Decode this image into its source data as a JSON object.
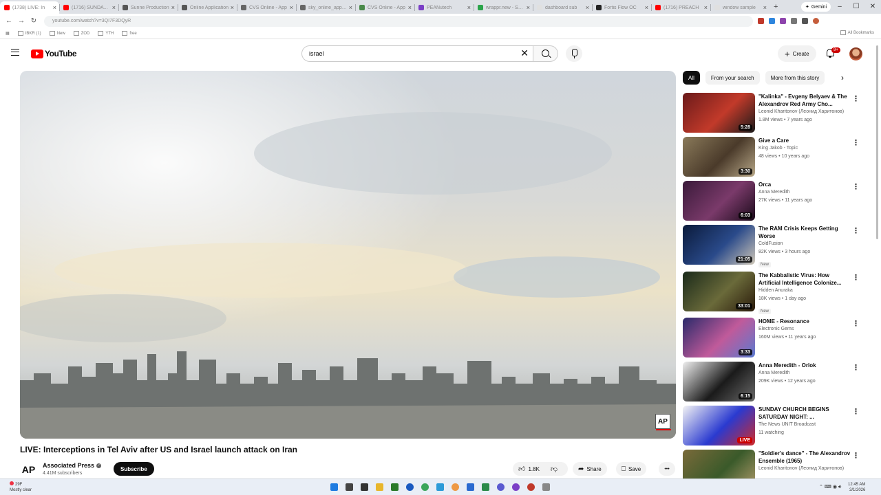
{
  "browser": {
    "tabs": [
      {
        "label": "(1738) LIVE: In",
        "color": "#ff0000",
        "active": true
      },
      {
        "label": "(1716) SUNDAY CH",
        "color": "#ff0000"
      },
      {
        "label": "Sunne Production",
        "color": "#555555"
      },
      {
        "label": "Online Application",
        "color": "#555555"
      },
      {
        "label": "CVS Online - App",
        "color": "#666666"
      },
      {
        "label": "sky_online_app_(1)",
        "color": "#666666"
      },
      {
        "label": "CVS Online - App",
        "color": "#4a8a4a"
      },
      {
        "label": "PEANutech",
        "color": "#7a3fc6"
      },
      {
        "label": "wrappr.new - Sunne",
        "color": "#2aa44a"
      },
      {
        "label": "dashboard sub",
        "color": "#e0e0e0"
      },
      {
        "label": "Fortis Flow OC",
        "color": "#222222"
      },
      {
        "label": "(1716) PREACH",
        "color": "#ff0000"
      },
      {
        "label": "window sample",
        "color": "#e0e0e0"
      }
    ],
    "new_tab": "+",
    "gemini_label": "Gemini",
    "url": "youtube.com/watch?v=3QI7F3DQyR",
    "bookmarks": [
      "IBKR (1)",
      "New",
      "ZOD",
      "YTH",
      "free"
    ],
    "all_bookmarks": "All Bookmarks",
    "window_controls": [
      "–",
      "☐",
      "✕"
    ]
  },
  "youtube": {
    "logo_text": "YouTube",
    "search_query": "israel",
    "create_label": "Create",
    "notification_count": "9+",
    "video": {
      "title": "LIVE: Interceptions in Tel Aviv after US and Israel launch attack on Iran",
      "watermark": "AP"
    },
    "channel": {
      "logo": "AP",
      "name": "Associated Press",
      "subscribers": "4.41M subscribers",
      "subscribe_label": "Subscribe"
    },
    "actions": {
      "likes": "1.8K",
      "share": "Share",
      "save": "Save",
      "more": "•••"
    },
    "chips": [
      "All",
      "From your search",
      "More from this story"
    ],
    "recommendations": [
      {
        "title": "\"Kalinka\" - Evgeny Belyaev & The Alexandrov Red Army Cho...",
        "channel": "Leonid Kharitonov (Леонид Харитонов)",
        "meta": "1.8M views • 7 years ago",
        "duration": "5:28",
        "new": "",
        "colors": [
          "#6a1a1a",
          "#c23a2a",
          "#1a1a1a"
        ]
      },
      {
        "title": "Give a Care",
        "channel": "King Jakob - Topic",
        "meta": "48 views • 10 years ago",
        "duration": "3:30",
        "new": "",
        "colors": [
          "#8a7a5a",
          "#4a3a2a",
          "#b8a888"
        ]
      },
      {
        "title": "Orca",
        "channel": "Anna Meredith",
        "meta": "27K views • 11 years ago",
        "duration": "6:03",
        "new": "",
        "colors": [
          "#3a1a3a",
          "#7a3a6a",
          "#1a0a1a"
        ]
      },
      {
        "title": "The RAM Crisis Keeps Getting Worse",
        "channel": "ColdFusion",
        "meta": "82K views • 3 hours ago",
        "duration": "21:05",
        "new": "New",
        "colors": [
          "#0a1a3a",
          "#2a4a8a",
          "#d0c8b8"
        ]
      },
      {
        "title": "The Kabbalistic Virus: How Artificial Intelligence Colonize...",
        "channel": "Hidden Anuraka",
        "meta": "18K views • 1 day ago",
        "duration": "33:01",
        "new": "New",
        "colors": [
          "#1a2a1a",
          "#6a6a3a",
          "#2a1a0a"
        ]
      },
      {
        "title": "HOME - Resonance",
        "channel": "Electronic Gems",
        "meta": "160M views • 11 years ago",
        "duration": "3:33",
        "new": "",
        "colors": [
          "#2a2a6a",
          "#c05a9a",
          "#5a7ad0"
        ]
      },
      {
        "title": "Anna Meredith - Orlok",
        "channel": "Anna Meredith",
        "meta": "209K views • 12 years ago",
        "duration": "6:15",
        "new": "",
        "colors": [
          "#f0f0f0",
          "#1a1a1a",
          "#6a6a6a"
        ]
      },
      {
        "title": "SUNDAY CHURCH BEGINS SATURDAY NIGHT: ...",
        "channel": "The News UNIT Broadcast",
        "meta": "11 watching",
        "duration": "LIVE",
        "new": "",
        "colors": [
          "#f4f4f4",
          "#2a3ad0",
          "#d02a2a"
        ]
      },
      {
        "title": "\"Soldier's dance\" - The Alexandrov Ensemble (1965)",
        "channel": "Leonid Kharitonov (Леонид Харитонов)",
        "meta": "",
        "duration": "",
        "new": "",
        "colors": [
          "#7a6a3a",
          "#3a5a2a",
          "#b09a6a"
        ]
      }
    ]
  },
  "taskbar": {
    "weather_temp": "29F",
    "weather_desc": "Mostly clear",
    "time": "12:45 AM",
    "date": "3/1/2026"
  }
}
